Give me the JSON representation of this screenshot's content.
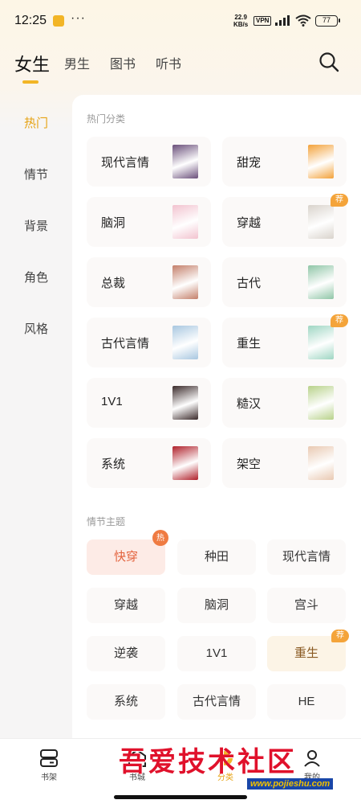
{
  "status_bar": {
    "time": "12:25",
    "more": "···",
    "net_speed_value": "22.9",
    "net_speed_unit": "KB/s",
    "vpn": "VPN",
    "battery": "77"
  },
  "top_tabs": [
    {
      "label": "女生",
      "active": true
    },
    {
      "label": "男生",
      "active": false
    },
    {
      "label": "图书",
      "active": false
    },
    {
      "label": "听书",
      "active": false
    }
  ],
  "sidebar": {
    "items": [
      {
        "label": "热门",
        "active": true
      },
      {
        "label": "情节",
        "active": false
      },
      {
        "label": "背景",
        "active": false
      },
      {
        "label": "角色",
        "active": false
      },
      {
        "label": "风格",
        "active": false
      }
    ]
  },
  "hot_categories": {
    "title": "热门分类",
    "items": [
      {
        "label": "现代言情",
        "badge": "",
        "cover_color": "#6a4f7a"
      },
      {
        "label": "甜宠",
        "badge": "",
        "cover_color": "#f3a23a"
      },
      {
        "label": "脑洞",
        "badge": "",
        "cover_color": "#f2c3cf"
      },
      {
        "label": "穿越",
        "badge": "荐",
        "cover_color": "#d9d3cc"
      },
      {
        "label": "总裁",
        "badge": "",
        "cover_color": "#c47f6a"
      },
      {
        "label": "古代",
        "badge": "",
        "cover_color": "#8fc6a7"
      },
      {
        "label": "古代言情",
        "badge": "",
        "cover_color": "#a8c7e0"
      },
      {
        "label": "重生",
        "badge": "荐",
        "cover_color": "#9fd6c3"
      },
      {
        "label": "1V1",
        "badge": "",
        "cover_color": "#3a2a2a"
      },
      {
        "label": "糙汉",
        "badge": "",
        "cover_color": "#b8d28a"
      },
      {
        "label": "系统",
        "badge": "",
        "cover_color": "#b0202a"
      },
      {
        "label": "架空",
        "badge": "",
        "cover_color": "#e9c9b2"
      }
    ]
  },
  "plot_themes": {
    "title": "情节主题",
    "items": [
      {
        "label": "快穿",
        "style": "hot",
        "badge": "热"
      },
      {
        "label": "种田",
        "style": "",
        "badge": ""
      },
      {
        "label": "现代言情",
        "style": "",
        "badge": ""
      },
      {
        "label": "穿越",
        "style": "",
        "badge": ""
      },
      {
        "label": "脑洞",
        "style": "",
        "badge": ""
      },
      {
        "label": "宫斗",
        "style": "",
        "badge": ""
      },
      {
        "label": "逆袭",
        "style": "",
        "badge": ""
      },
      {
        "label": "1V1",
        "style": "",
        "badge": ""
      },
      {
        "label": "重生",
        "style": "warm",
        "badge": "荐"
      },
      {
        "label": "系统",
        "style": "",
        "badge": ""
      },
      {
        "label": "古代言情",
        "style": "",
        "badge": ""
      },
      {
        "label": "HE",
        "style": "",
        "badge": ""
      }
    ]
  },
  "bottom_nav": [
    {
      "label": "书架",
      "icon": "bookshelf-icon",
      "active": false
    },
    {
      "label": "书城",
      "icon": "bookstore-icon",
      "active": false
    },
    {
      "label": "分类",
      "icon": "category-icon",
      "active": true
    },
    {
      "label": "我的",
      "icon": "profile-icon",
      "active": false
    }
  ],
  "watermark": {
    "text": "吾爱技术社区",
    "url": "www.pojieshu.com"
  },
  "colors": {
    "accent": "#e6a213",
    "tab_indicator": "#f2b526",
    "rec_badge": "#f4a43a",
    "hot_chip_text": "#e3623c"
  }
}
